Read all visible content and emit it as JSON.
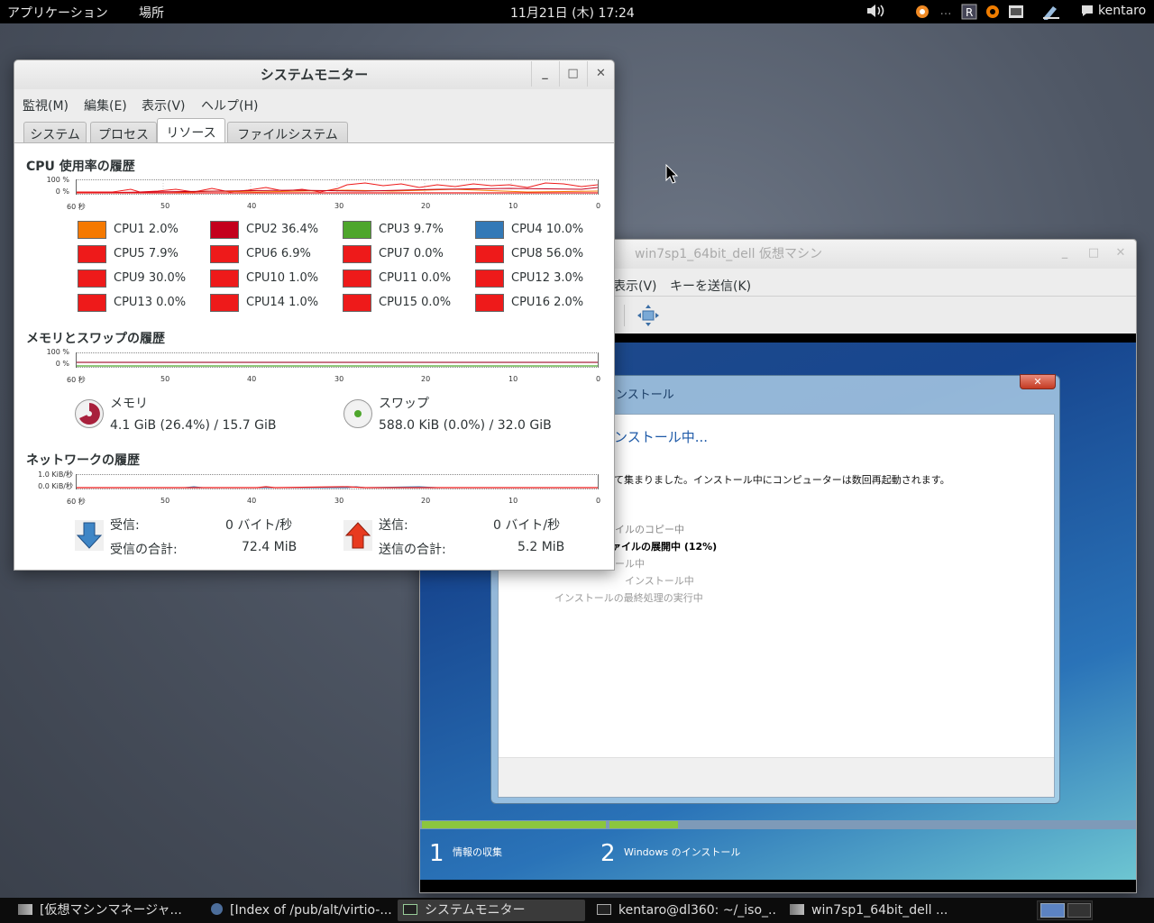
{
  "topbar": {
    "applications": "アプリケーション",
    "places": "場所",
    "clock": "11月21日 (木) 17:24",
    "user": "kentaro",
    "icons": [
      "volume-icon",
      "update-icon",
      "dots-icon",
      "r-icon",
      "gear-icon",
      "wb-icon",
      "pen-icon",
      "chat-icon"
    ]
  },
  "sysmon": {
    "title": "システムモニター",
    "menu": [
      "監視(M)",
      "編集(E)",
      "表示(V)",
      "ヘルプ(H)"
    ],
    "tabs": [
      "システム",
      "プロセス",
      "リソース",
      "ファイルシステム"
    ],
    "active_tab": "リソース",
    "cpu": {
      "title": "CPU 使用率の履歴",
      "y_top": "100 %",
      "y_bottom": "0 %",
      "x_labels": [
        "60 秒",
        "50",
        "40",
        "30",
        "20",
        "10",
        "0"
      ],
      "items": [
        {
          "label": "CPU1 2.0%",
          "color": "#f57900"
        },
        {
          "label": "CPU2 36.4%",
          "color": "#c4001c"
        },
        {
          "label": "CPU3 9.7%",
          "color": "#4ea62c"
        },
        {
          "label": "CPU4 10.0%",
          "color": "#3379b7"
        },
        {
          "label": "CPU5 7.9%",
          "color": "#ee1a1a"
        },
        {
          "label": "CPU6 6.9%",
          "color": "#ee1a1a"
        },
        {
          "label": "CPU7 0.0%",
          "color": "#ee1a1a"
        },
        {
          "label": "CPU8 56.0%",
          "color": "#ee1a1a"
        },
        {
          "label": "CPU9 30.0%",
          "color": "#ee1a1a"
        },
        {
          "label": "CPU10 1.0%",
          "color": "#ee1a1a"
        },
        {
          "label": "CPU11 0.0%",
          "color": "#ee1a1a"
        },
        {
          "label": "CPU12 3.0%",
          "color": "#ee1a1a"
        },
        {
          "label": "CPU13 0.0%",
          "color": "#ee1a1a"
        },
        {
          "label": "CPU14 1.0%",
          "color": "#ee1a1a"
        },
        {
          "label": "CPU15 0.0%",
          "color": "#ee1a1a"
        },
        {
          "label": "CPU16 2.0%",
          "color": "#ee1a1a"
        }
      ]
    },
    "memory": {
      "title": "メモリとスワップの履歴",
      "y_top": "100 %",
      "y_bottom": "0 %",
      "mem_label": "メモリ",
      "mem_value": "4.1 GiB (26.4%) / 15.7 GiB",
      "swap_label": "スワップ",
      "swap_value": "588.0 KiB (0.0%) / 32.0 GiB",
      "mem_color": "#a8203c",
      "swap_color": "#4ea62c"
    },
    "network": {
      "title": "ネットワークの履歴",
      "y_top": "1.0 KiB/秒",
      "y_bottom": "0.0 KiB/秒",
      "recv_label": "受信:",
      "recv_value": "0 バイト/秒",
      "recv_total_label": "受信の合計:",
      "recv_total_value": "72.4 MiB",
      "send_label": "送信:",
      "send_value": "0 バイト/秒",
      "send_total_label": "送信の合計:",
      "send_total_value": "5.2 MiB"
    }
  },
  "vm": {
    "title": "win7sp1_64bit_dell 仮想マシン",
    "menu": [
      "表示(V)",
      "キーを送信(K)"
    ],
    "setup": {
      "title": "ンストール",
      "heading": "ンストール中...",
      "message": "て集まりました。インストール中にコンピューターは数回再起動されます。",
      "steps": [
        "イルのコピー中",
        "ァイルの展開中 (12%)",
        "ール中",
        "インストール中",
        "インストールの最終処理の実行中"
      ],
      "phase1_num": "1",
      "phase1_label": "情報の収集",
      "phase2_num": "2",
      "phase2_label": "Windows のインストール"
    }
  },
  "taskbar": {
    "items": [
      "[仮想マシンマネージャ...",
      "[Index of /pub/alt/virtio-...",
      "システムモニター",
      "kentaro@dl360: ~/_iso_...",
      "win7sp1_64bit_dell ..."
    ]
  }
}
